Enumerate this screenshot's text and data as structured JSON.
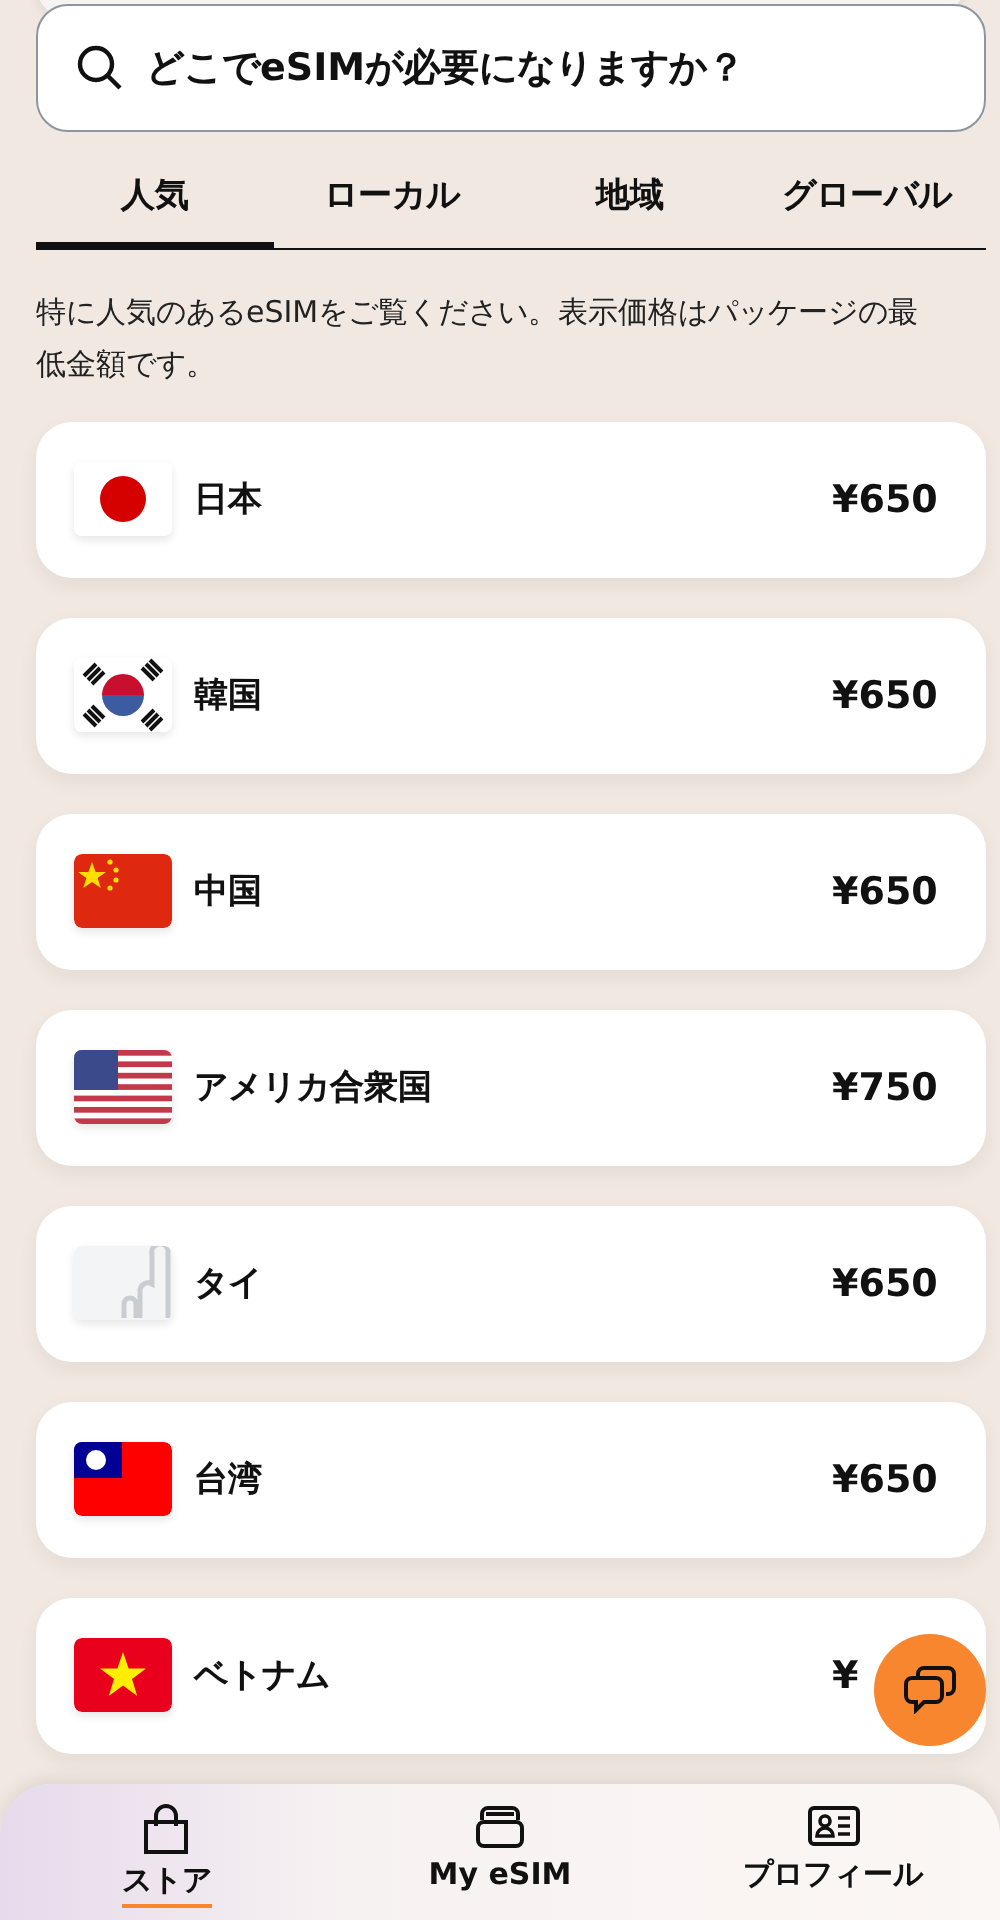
{
  "search": {
    "placeholder": "どこでeSIMが必要になりますか？"
  },
  "tabs": [
    {
      "label": "人気",
      "selected": true
    },
    {
      "label": "ローカル",
      "selected": false
    },
    {
      "label": "地域",
      "selected": false
    },
    {
      "label": "グローバル",
      "selected": false
    }
  ],
  "description": "特に人気のあるeSIMをご覧ください。表示価格はパッケージの最低金額です。",
  "destinations": [
    {
      "kind": "jp",
      "name": "日本",
      "price": "¥650"
    },
    {
      "kind": "kr",
      "name": "韓国",
      "price": "¥650"
    },
    {
      "kind": "cn",
      "name": "中国",
      "price": "¥650"
    },
    {
      "kind": "us",
      "name": "アメリカ合衆国",
      "price": "¥750"
    },
    {
      "kind": "placeholder",
      "name": "タイ",
      "price": "¥650"
    },
    {
      "kind": "tw",
      "name": "台湾",
      "price": "¥650"
    },
    {
      "kind": "vn",
      "name": "ベトナム",
      "price": "¥"
    }
  ],
  "bottom_nav": [
    {
      "kind": "bag",
      "label": "ストア",
      "selected": true
    },
    {
      "kind": "cards",
      "label": "My eSIM",
      "selected": false
    },
    {
      "kind": "idcard",
      "label": "プロフィール",
      "selected": false
    }
  ]
}
